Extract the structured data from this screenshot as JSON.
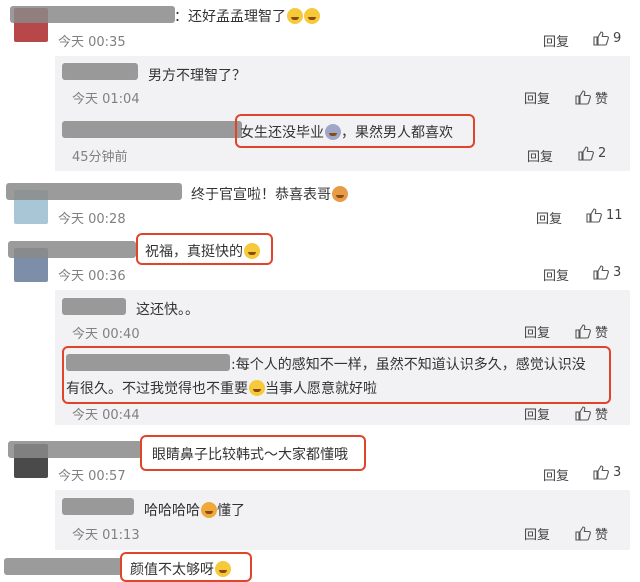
{
  "comments": [
    {
      "text": "：还好孟孟理智了",
      "time": "今天 00:35",
      "reply_label": "回复",
      "likes": "9"
    },
    {
      "text": "终于官宣啦！恭喜表哥",
      "time": "今天 00:28",
      "reply_label": "回复",
      "likes": "11"
    },
    {
      "text": "祝福，真挺快的",
      "time": "今天 00:36",
      "reply_label": "回复",
      "likes": "3"
    },
    {
      "text": "眼睛鼻子比较韩式～大家都懂哦",
      "time": "今天 00:57",
      "reply_label": "回复",
      "likes": "3"
    },
    {
      "text": "颜值不太够呀"
    }
  ],
  "replies": [
    {
      "text": "男方不理智了？",
      "time": "今天 01:04",
      "reply_label": "回复",
      "likes": "赞"
    },
    {
      "text": "女生还没毕业",
      "text2": "，果然男人都喜欢",
      "time": "45分钟前",
      "reply_label": "回复",
      "likes": "2"
    },
    {
      "text": "这还快。。",
      "time": "今天 00:40",
      "reply_label": "回复",
      "likes": "赞"
    },
    {
      "line1": ":每个人的感知不一样，虽然不知道认识多久，感觉认识没",
      "line2a": "有很久。不过我觉得也不重要",
      "line2b": "当事人愿意就好啦",
      "time": "今天 00:44",
      "reply_label": "回复",
      "likes": "赞"
    },
    {
      "text": "哈哈哈哈",
      "text2": "懂了",
      "time": "今天 01:13",
      "reply_label": "回复",
      "likes": "赞"
    }
  ],
  "colors": {
    "highlight": "#e0452c",
    "reply_bg": "#f2f2f5",
    "time": "#808080"
  },
  "icons": [
    "thumb-up-icon",
    "laugh-emoji",
    "party-emoji",
    "avatar"
  ]
}
